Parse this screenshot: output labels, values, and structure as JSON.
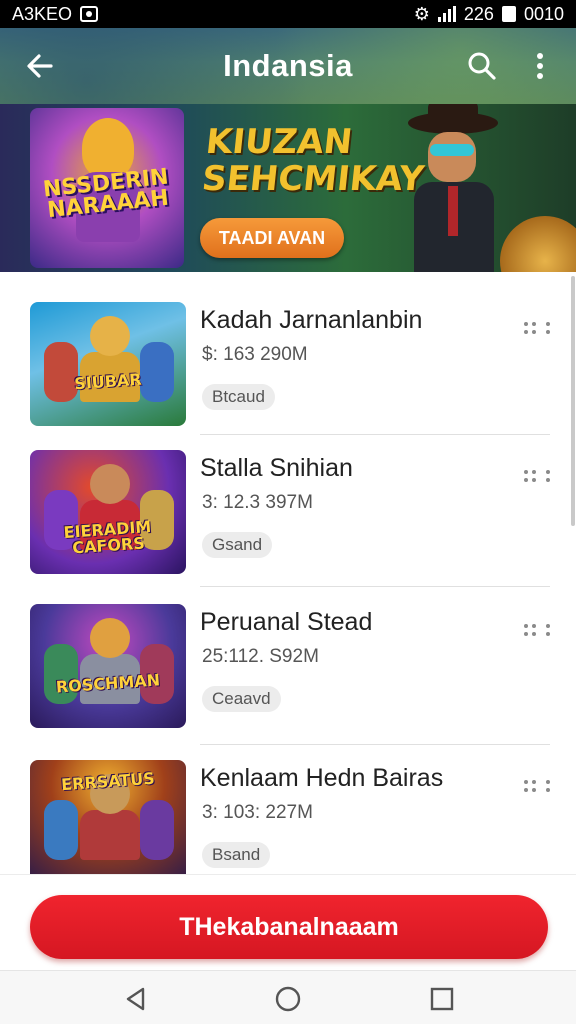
{
  "status_bar": {
    "left_text": "A3KEO",
    "signal_label": "226",
    "time": "0010"
  },
  "header": {
    "title": "Indansia",
    "back_icon": "arrow-left-icon",
    "search_icon": "search-icon",
    "more_icon": "more-vertical-icon"
  },
  "banner": {
    "art_text": "NSSDERIN NARAAAH",
    "headline_line1": "KIUZAN",
    "headline_line2": "SEHCMIKAY",
    "button_label": "TAADI AVAN"
  },
  "games": [
    {
      "title": "Kadah Jarnanlanbin",
      "meta": "$: 163 290M",
      "badge": "Btcaud",
      "thumb_text": "SIUBAR",
      "colors": {
        "bg1": "#1f9ad6",
        "bg2": "#2a7a3a",
        "head": "#e6b248",
        "body": "#d9a331",
        "side1": "#c24a3a",
        "side2": "#3a6fc2"
      }
    },
    {
      "title": "Stalla Snihian",
      "meta": "3: 12.3 397M",
      "badge": "Gsand",
      "thumb_text": "EIERADIM CAFORS",
      "colors": {
        "bg1": "#6a2fb0",
        "bg2": "#d84a2a",
        "head": "#c98a5a",
        "body": "#c82a36",
        "side1": "#7a3ac0",
        "side2": "#c8a24a"
      }
    },
    {
      "title": "Peruanal Stead",
      "meta": "25:112. S92M",
      "badge": "Ceaavd",
      "thumb_text": "ROSCHMAN",
      "colors": {
        "bg1": "#2a3a8a",
        "bg2": "#c24ac0",
        "head": "#e0a040",
        "body": "#8a8fa0",
        "side1": "#3a8a5a",
        "side2": "#a03a5a"
      }
    },
    {
      "title": "Kenlaam Hedn Bairas",
      "meta": "3: 103: 227M",
      "badge": "Bsand",
      "thumb_text": "ERRSATUS",
      "colors": {
        "bg1": "#d48a1a",
        "bg2": "#3a2a6a",
        "head": "#c89a5a",
        "body": "#b03a3a",
        "side1": "#3a7ac0",
        "side2": "#6a3aa0"
      }
    }
  ],
  "cta": {
    "label": "THekabanalnaaam"
  },
  "nav": {
    "back_icon": "triangle-back-icon",
    "home_icon": "circle-home-icon",
    "recents_icon": "square-recents-icon"
  }
}
